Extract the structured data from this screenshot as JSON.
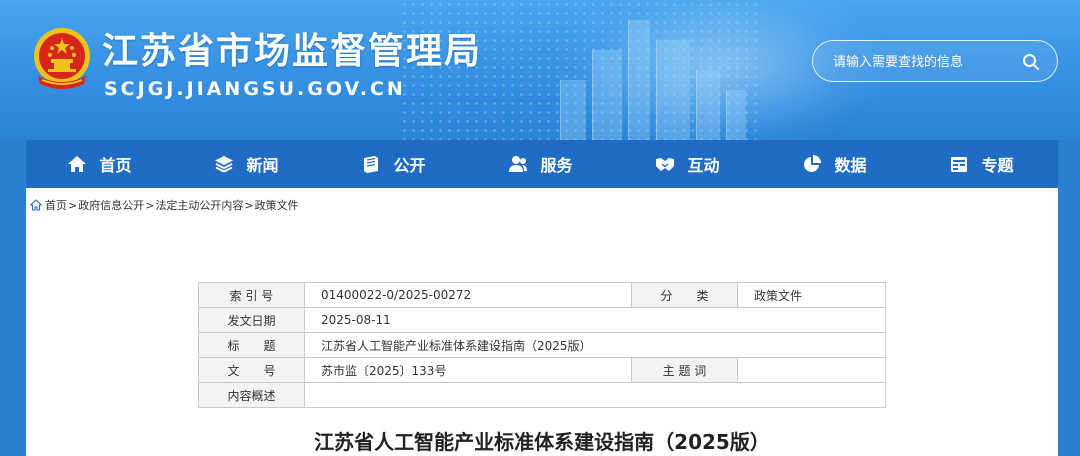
{
  "header": {
    "title": "江苏省市场监督管理局",
    "url": "SCJGJ.JIANGSU.GOV.CN",
    "search_placeholder": "请输入需要查找的信息"
  },
  "nav": {
    "items": [
      {
        "label": "首页",
        "icon": "home-icon"
      },
      {
        "label": "新闻",
        "icon": "layers-icon"
      },
      {
        "label": "公开",
        "icon": "book-icon"
      },
      {
        "label": "服务",
        "icon": "users-icon"
      },
      {
        "label": "互动",
        "icon": "handshake-icon"
      },
      {
        "label": "数据",
        "icon": "pie-chart-icon"
      },
      {
        "label": "专题",
        "icon": "calendar-icon"
      }
    ]
  },
  "breadcrumb": [
    "首页",
    "政府信息公开",
    "法定主动公开内容",
    "政策文件"
  ],
  "meta": {
    "index_label": "索 引 号",
    "index_value": "01400022-0/2025-00272",
    "category_label": "分　　类",
    "category_value": "政策文件",
    "date_label": "发文日期",
    "date_value": "2025-08-11",
    "title_label": "标　　题",
    "title_value": "江苏省人工智能产业标准体系建设指南（2025版）",
    "doc_no_label": "文　　号",
    "doc_no_value": "苏市监〔2025〕133号",
    "keywords_label": "主 题 词",
    "keywords_value": "",
    "summary_label": "内容概述",
    "summary_value": ""
  },
  "document": {
    "title": "江苏省人工智能产业标准体系建设指南（2025版）"
  },
  "colors": {
    "banner": "#3b95e6",
    "nav": "#1f6cc4",
    "emblem_red": "#d7261c",
    "emblem_gold": "#f2c31c"
  }
}
